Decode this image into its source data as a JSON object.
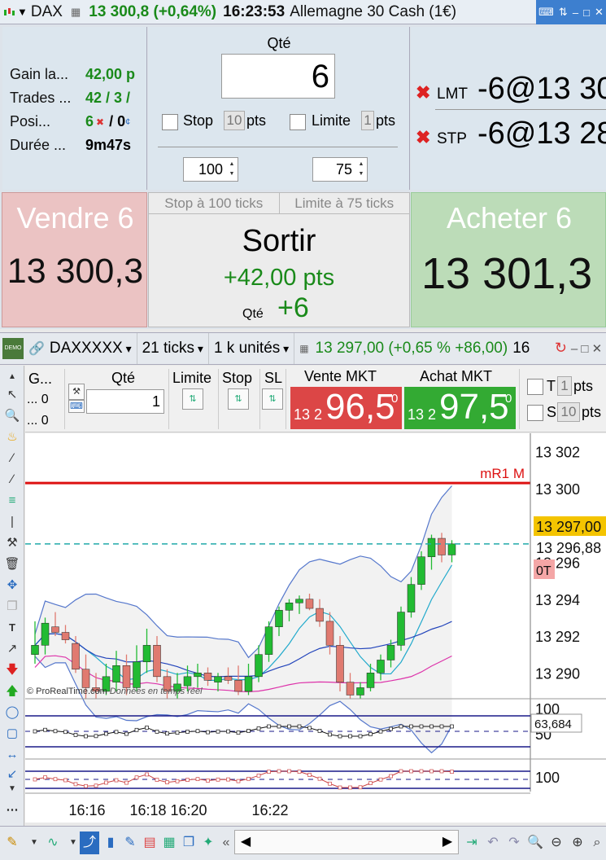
{
  "titlebar": {
    "symbol": "DAX",
    "price_change": "13 300,8 (+0,64%)",
    "time": "16:23:53",
    "instrument_name": "Allemagne 30 Cash (1€)"
  },
  "stats": {
    "rows": [
      {
        "label": "Gain la...",
        "value": "42,00 p",
        "value_color": "#1a8a1a"
      },
      {
        "label": "Trades ...",
        "value": "42 / 3 /",
        "value_color": "#1a8a1a"
      },
      {
        "label": "Posi...",
        "value": "6",
        "value_extra": "/ 0",
        "value_color": "#1a8a1a"
      },
      {
        "label": "Durée ...",
        "value": "9m47s",
        "value_color": "#111111"
      }
    ]
  },
  "order": {
    "qty_label": "Qté",
    "qty_value": "6",
    "stop_label": "Stop",
    "stop_pts": "10",
    "pts_label": "pts",
    "limit_label": "Limite",
    "limit_pts": "1",
    "stop_ticks": "100",
    "limit_ticks": "75"
  },
  "pending": {
    "lmt": {
      "type": "LMT",
      "value": "-6@13 30"
    },
    "stp": {
      "type": "STP",
      "value": "-6@13 28"
    }
  },
  "sell": {
    "label": "Vendre 6",
    "price": "13 300,3"
  },
  "buy": {
    "label": "Acheter 6",
    "price": "13 301,3"
  },
  "exit": {
    "tab_stop": "Stop à 100 ticks",
    "tab_limit": "Limite à 75 ticks",
    "label": "Sortir",
    "gain": "+42,00 pts",
    "qty_label": "Qté",
    "qty_value": "+6"
  },
  "chartbar": {
    "ticker": "DAXXXXX",
    "interval": "21 ticks",
    "units": "1 k unités",
    "quote": "13 297,00 (+0,65 % +86,00)",
    "quote_cut": "16"
  },
  "tradebar": {
    "g_label": "G...",
    "g_row1": "... 0",
    "g_row2": "... 0",
    "qty_label": "Qté",
    "qty_value": "1",
    "limit_label": "Limite",
    "stop_label": "Stop",
    "sl_label": "SL",
    "sell_mkt_label": "Vente MKT",
    "buy_mkt_label": "Achat MKT",
    "sell_pre": "13 2",
    "sell_main": "96,5",
    "sell_sup": "0",
    "buy_pre": "13 2",
    "buy_main": "97,5",
    "buy_sup": "0",
    "t_label": "T",
    "t_value": "1",
    "s_label": "S",
    "s_value": "10",
    "pts_label": "pts"
  },
  "chart": {
    "copyright": "© ProRealTime.com",
    "copyright_note": "Données en temps réel",
    "level_label": "mR1 M",
    "price_tag": "13 297,00",
    "price_tag2": "13 296,88",
    "ot_badge": "0T",
    "osc_tag": "63,684",
    "osc1_tick_top": "100",
    "osc1_tick_bottom": "50",
    "osc2_tick": "100",
    "colors": {
      "up": "#22bb33",
      "down": "#e07a70",
      "level": "#d11",
      "band": "#5577cc",
      "ma_fast": "#22aacc",
      "ma_slow": "#2244bb",
      "ma_long": "#dd33aa"
    }
  },
  "chart_data": {
    "type": "candlestick",
    "ylim": [
      13288.6,
      13303
    ],
    "y_ticks": [
      "13 302",
      "13 300",
      "13 298",
      "13 296",
      "13 294",
      "13 292",
      "13 290"
    ],
    "y_tick_values": [
      13302,
      13300,
      13298,
      13296,
      13294,
      13292,
      13290
    ],
    "x_tick_labels": [
      "16:16",
      "16:18",
      "16:20",
      "16:22"
    ],
    "x_tick_bars": [
      4,
      10,
      14,
      22
    ],
    "level_value": 13300.3,
    "last_value": 13297.0,
    "ohlc": [
      [
        13291.0,
        13292.8,
        13290.5,
        13291.5
      ],
      [
        13291.5,
        13293.0,
        13291.0,
        13292.7
      ],
      [
        13292.5,
        13293.3,
        13292.0,
        13292.2
      ],
      [
        13292.2,
        13292.6,
        13291.6,
        13291.8
      ],
      [
        13291.6,
        13292.0,
        13290.0,
        13290.2
      ],
      [
        13290.2,
        13291.0,
        13288.6,
        13289.2
      ],
      [
        13289.2,
        13290.0,
        13288.6,
        13289.0
      ],
      [
        13289.0,
        13290.5,
        13288.8,
        13289.8
      ],
      [
        13289.5,
        13291.2,
        13289.0,
        13290.4
      ],
      [
        13290.4,
        13291.0,
        13288.8,
        13289.2
      ],
      [
        13289.2,
        13291.5,
        13289.0,
        13290.6
      ],
      [
        13290.6,
        13292.4,
        13290.0,
        13291.5
      ],
      [
        13291.5,
        13292.0,
        13289.5,
        13289.8
      ],
      [
        13289.8,
        13290.2,
        13288.6,
        13289.0
      ],
      [
        13289.0,
        13290.0,
        13288.6,
        13289.4
      ],
      [
        13289.3,
        13290.4,
        13289.0,
        13289.8
      ],
      [
        13289.8,
        13290.5,
        13289.2,
        13290.0
      ],
      [
        13290.0,
        13290.3,
        13289.3,
        13289.6
      ],
      [
        13289.5,
        13290.0,
        13289.0,
        13289.8
      ],
      [
        13289.8,
        13290.3,
        13289.4,
        13289.6
      ],
      [
        13289.6,
        13290.4,
        13288.8,
        13289.0
      ],
      [
        13289.0,
        13290.5,
        13288.8,
        13289.8
      ],
      [
        13289.8,
        13291.5,
        13289.5,
        13291.0
      ],
      [
        13291.0,
        13292.8,
        13290.6,
        13292.5
      ],
      [
        13292.5,
        13293.6,
        13292.0,
        13293.4
      ],
      [
        13293.4,
        13294.0,
        13292.8,
        13293.8
      ],
      [
        13293.8,
        13294.2,
        13293.2,
        13294.0
      ],
      [
        13294.0,
        13294.3,
        13293.4,
        13293.5
      ],
      [
        13293.5,
        13294.0,
        13292.5,
        13292.8
      ],
      [
        13292.8,
        13293.3,
        13291.0,
        13291.5
      ],
      [
        13291.5,
        13292.0,
        13289.0,
        13289.5
      ],
      [
        13289.5,
        13290.0,
        13288.6,
        13288.8
      ],
      [
        13288.8,
        13289.5,
        13288.6,
        13289.2
      ],
      [
        13289.2,
        13290.5,
        13289.0,
        13290.0
      ],
      [
        13290.0,
        13291.0,
        13289.6,
        13290.7
      ],
      [
        13290.7,
        13291.8,
        13290.3,
        13291.5
      ],
      [
        13291.5,
        13293.6,
        13291.2,
        13293.3
      ],
      [
        13293.3,
        13295.2,
        13293.0,
        13294.8
      ],
      [
        13294.8,
        13296.6,
        13294.5,
        13296.3
      ],
      [
        13296.3,
        13297.5,
        13295.6,
        13297.3
      ],
      [
        13297.3,
        13297.6,
        13296.0,
        13296.4
      ],
      [
        13296.4,
        13297.2,
        13296.0,
        13297.0
      ]
    ]
  }
}
